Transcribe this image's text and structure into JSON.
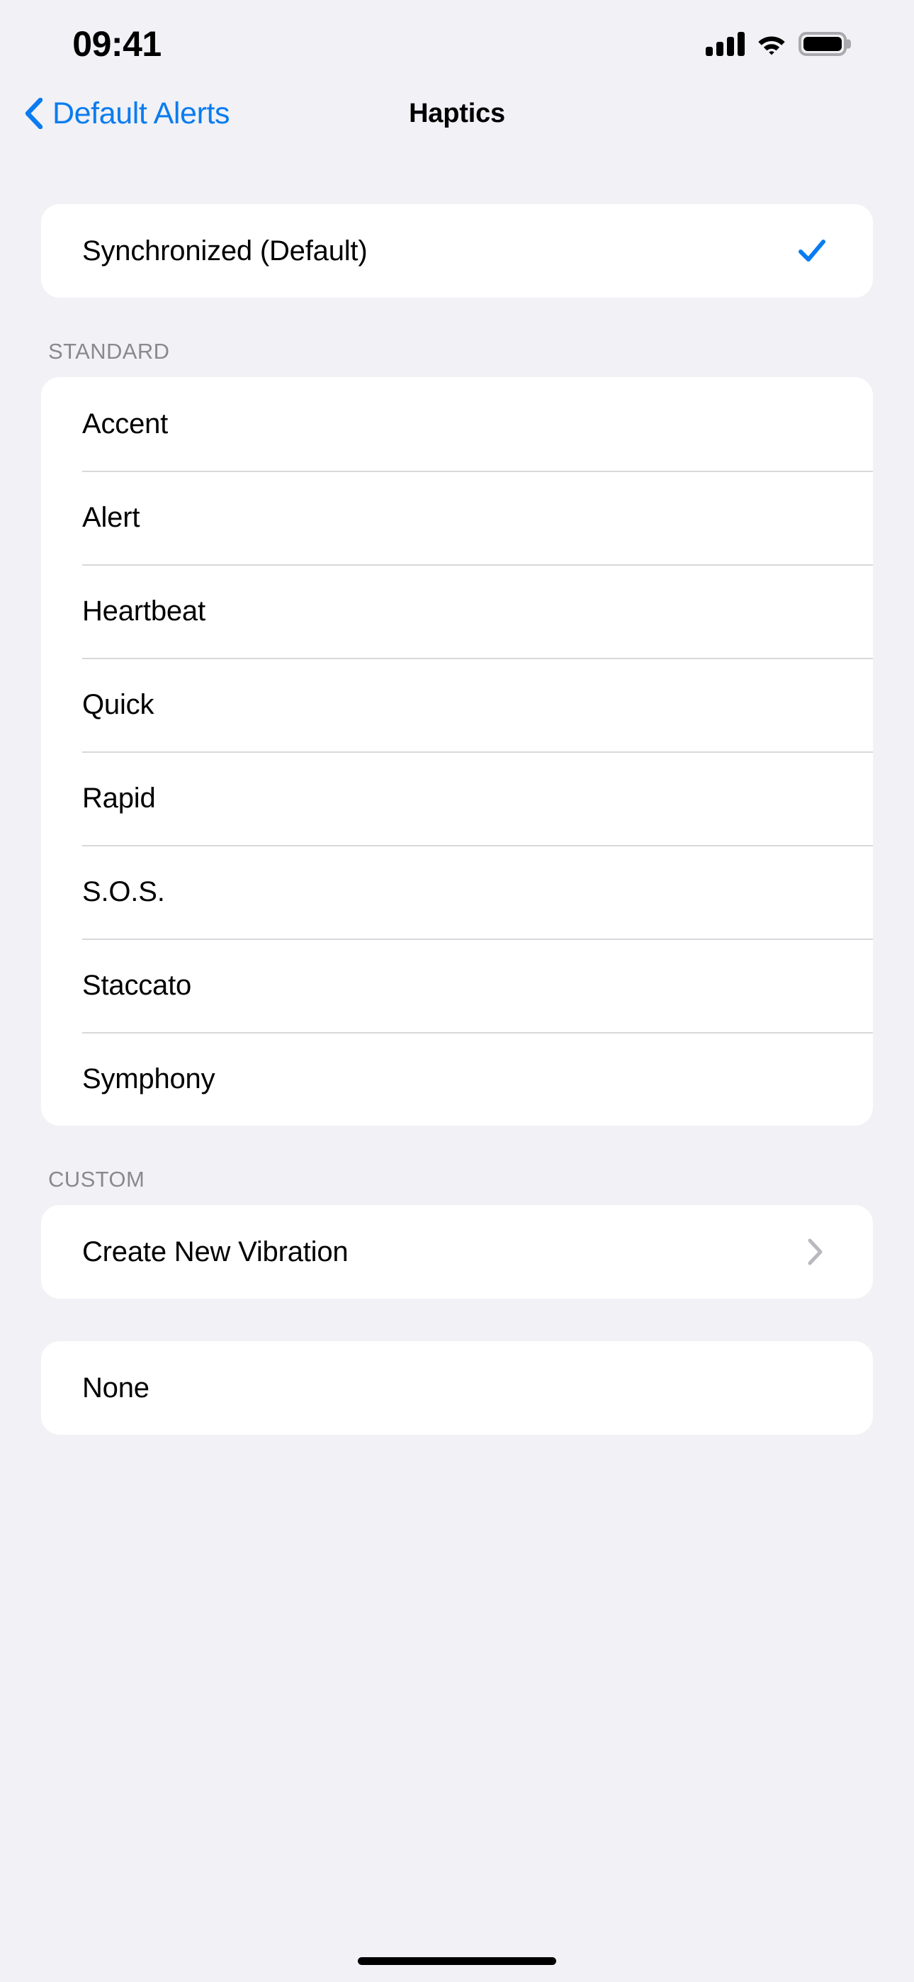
{
  "status_bar": {
    "time": "09:41",
    "cellular_icon": "cellular-signal-icon",
    "wifi_icon": "wifi-icon",
    "battery_icon": "battery-full-icon",
    "signal_bars": 4
  },
  "nav_bar": {
    "back_label": "Default Alerts",
    "back_icon": "chevron-left-icon",
    "title": "Haptics"
  },
  "selected_section": {
    "rows": [
      {
        "label": "Synchronized (Default)",
        "accessory": "checkmark",
        "selected": true
      }
    ]
  },
  "standard_section": {
    "header": "STANDARD",
    "rows": [
      {
        "label": "Accent",
        "accessory": "none"
      },
      {
        "label": "Alert",
        "accessory": "none"
      },
      {
        "label": "Heartbeat",
        "accessory": "none"
      },
      {
        "label": "Quick",
        "accessory": "none"
      },
      {
        "label": "Rapid",
        "accessory": "none"
      },
      {
        "label": "S.O.S.",
        "accessory": "none"
      },
      {
        "label": "Staccato",
        "accessory": "none"
      },
      {
        "label": "Symphony",
        "accessory": "none"
      }
    ]
  },
  "custom_section": {
    "header": "CUSTOM",
    "rows": [
      {
        "label": "Create New Vibration",
        "accessory": "chevron"
      }
    ]
  },
  "none_section": {
    "rows": [
      {
        "label": "None",
        "accessory": "none"
      }
    ]
  },
  "colors": {
    "accent_blue": "#0a7cf0",
    "page_background": "#f1f1f6",
    "card_background": "#ffffff",
    "separator": "#d8d8dc",
    "header_gray": "#8a8a8e",
    "chevron_gray": "#b9b9bd"
  }
}
